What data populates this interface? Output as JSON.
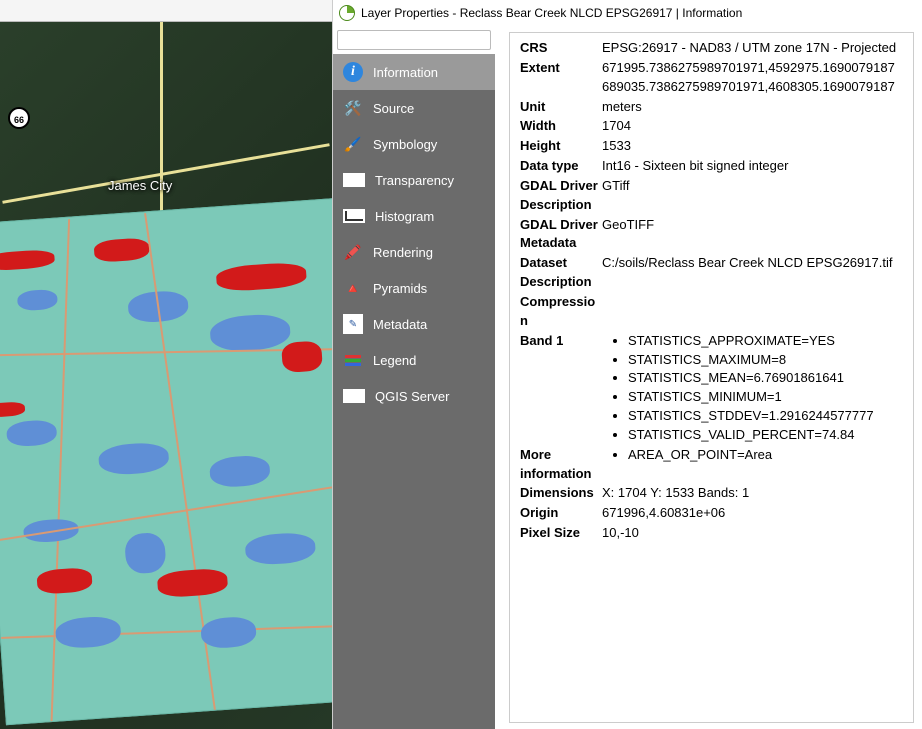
{
  "map": {
    "shield": "66",
    "city": "James City"
  },
  "dialog": {
    "title": "Layer Properties - Reclass Bear Creek NLCD EPSG26917 | Information",
    "search_placeholder": ""
  },
  "sidebar": {
    "items": [
      {
        "icon": "info",
        "label": "Information",
        "active": true
      },
      {
        "icon": "wrench",
        "label": "Source"
      },
      {
        "icon": "brush",
        "label": "Symbology"
      },
      {
        "icon": "trans",
        "label": "Transparency"
      },
      {
        "icon": "hist",
        "label": "Histogram"
      },
      {
        "icon": "render",
        "label": "Rendering"
      },
      {
        "icon": "pyr",
        "label": "Pyramids"
      },
      {
        "icon": "meta",
        "label": "Metadata"
      },
      {
        "icon": "legend",
        "label": "Legend"
      },
      {
        "icon": "server",
        "label": "QGIS Server"
      }
    ]
  },
  "info": {
    "crs_label": "CRS",
    "crs": "EPSG:26917 - NAD83 / UTM zone 17N - Projected",
    "extent_label": "Extent",
    "extent": "671995.7386275989701971,4592975.1690079187 689035.7386275989701971,4608305.1690079187",
    "unit_label": "Unit",
    "unit": "meters",
    "width_label": "Width",
    "width": "1704",
    "height_label": "Height",
    "height": "1533",
    "dtype_label": "Data type",
    "dtype": "Int16 - Sixteen bit signed integer",
    "gdal_desc_label": "GDAL Driver Description",
    "gdal_desc": "GTiff",
    "gdal_meta_label": "GDAL Driver Metadata",
    "gdal_meta": "GeoTIFF",
    "dataset_desc_label": "Dataset Description",
    "dataset_desc": "C:/soils/Reclass Bear Creek NLCD EPSG26917.tif",
    "compression_label": "Compression",
    "compression": "",
    "band1_label": "Band 1",
    "band1_stats": [
      "STATISTICS_APPROXIMATE=YES",
      "STATISTICS_MAXIMUM=8",
      "STATISTICS_MEAN=6.76901861641",
      "STATISTICS_MINIMUM=1",
      "STATISTICS_STDDEV=1.2916244577777",
      "STATISTICS_VALID_PERCENT=74.84"
    ],
    "moreinfo_label": "More information",
    "moreinfo_items": [
      "AREA_OR_POINT=Area"
    ],
    "dimensions_label": "Dimensions",
    "dimensions": "X: 1704 Y: 1533 Bands: 1",
    "origin_label": "Origin",
    "origin": "671996,4.60831e+06",
    "pixelsize_label": "Pixel Size",
    "pixelsize": "10,-10"
  }
}
